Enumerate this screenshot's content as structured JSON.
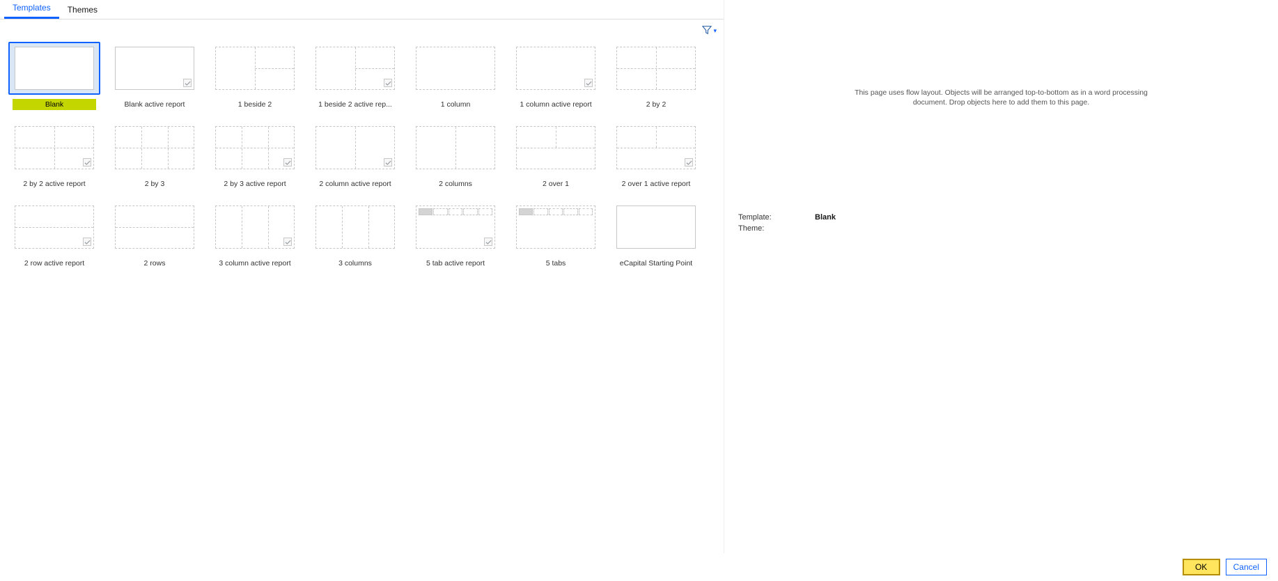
{
  "tabs": {
    "templates": "Templates",
    "themes": "Themes",
    "active": "templates"
  },
  "preview": {
    "description": "This page uses flow layout. Objects will be arranged top-to-bottom as in a word processing document. Drop objects here to add them to this page.",
    "template_label": "Template:",
    "template_value": "Blank",
    "theme_label": "Theme:",
    "theme_value": ""
  },
  "buttons": {
    "ok": "OK",
    "cancel": "Cancel"
  },
  "templates": [
    {
      "id": "blank",
      "label": "Blank",
      "kind": "blank",
      "active": false,
      "selected": true
    },
    {
      "id": "blank-active",
      "label": "Blank active report",
      "kind": "blank",
      "active": true,
      "selected": false
    },
    {
      "id": "1beside2",
      "label": "1 beside 2",
      "kind": "1beside2",
      "active": false,
      "selected": false
    },
    {
      "id": "1beside2-active",
      "label": "1 beside 2 active rep...",
      "kind": "1beside2",
      "active": true,
      "selected": false
    },
    {
      "id": "1column",
      "label": "1 column",
      "kind": "1col",
      "active": false,
      "selected": false
    },
    {
      "id": "1column-active",
      "label": "1 column active report",
      "kind": "1col",
      "active": true,
      "selected": false
    },
    {
      "id": "2by2",
      "label": "2 by 2",
      "kind": "2by2",
      "active": false,
      "selected": false
    },
    {
      "id": "2by2-active",
      "label": "2 by 2 active report",
      "kind": "2by2",
      "active": true,
      "selected": false
    },
    {
      "id": "2by3",
      "label": "2 by 3",
      "kind": "2by3",
      "active": false,
      "selected": false
    },
    {
      "id": "2by3-active",
      "label": "2 by 3 active report",
      "kind": "2by3",
      "active": true,
      "selected": false
    },
    {
      "id": "2col-active",
      "label": "2 column active report",
      "kind": "2col",
      "active": true,
      "selected": false
    },
    {
      "id": "2col",
      "label": "2 columns",
      "kind": "2col",
      "active": false,
      "selected": false
    },
    {
      "id": "2over1",
      "label": "2 over 1",
      "kind": "2over1",
      "active": false,
      "selected": false
    },
    {
      "id": "2over1-active",
      "label": "2 over 1 active report",
      "kind": "2over1",
      "active": true,
      "selected": false
    },
    {
      "id": "2row-active",
      "label": "2 row active report",
      "kind": "2row",
      "active": true,
      "selected": false
    },
    {
      "id": "2row",
      "label": "2 rows",
      "kind": "2row",
      "active": false,
      "selected": false
    },
    {
      "id": "3col-active",
      "label": "3 column active report",
      "kind": "3col",
      "active": true,
      "selected": false
    },
    {
      "id": "3col",
      "label": "3 columns",
      "kind": "3col",
      "active": false,
      "selected": false
    },
    {
      "id": "5tab-active",
      "label": "5 tab active report",
      "kind": "5tab",
      "active": true,
      "selected": false
    },
    {
      "id": "5tab",
      "label": "5 tabs",
      "kind": "5tab",
      "active": false,
      "selected": false
    },
    {
      "id": "ecapital",
      "label": "eCapital Starting Point",
      "kind": "ecapital",
      "active": false,
      "selected": false
    }
  ]
}
